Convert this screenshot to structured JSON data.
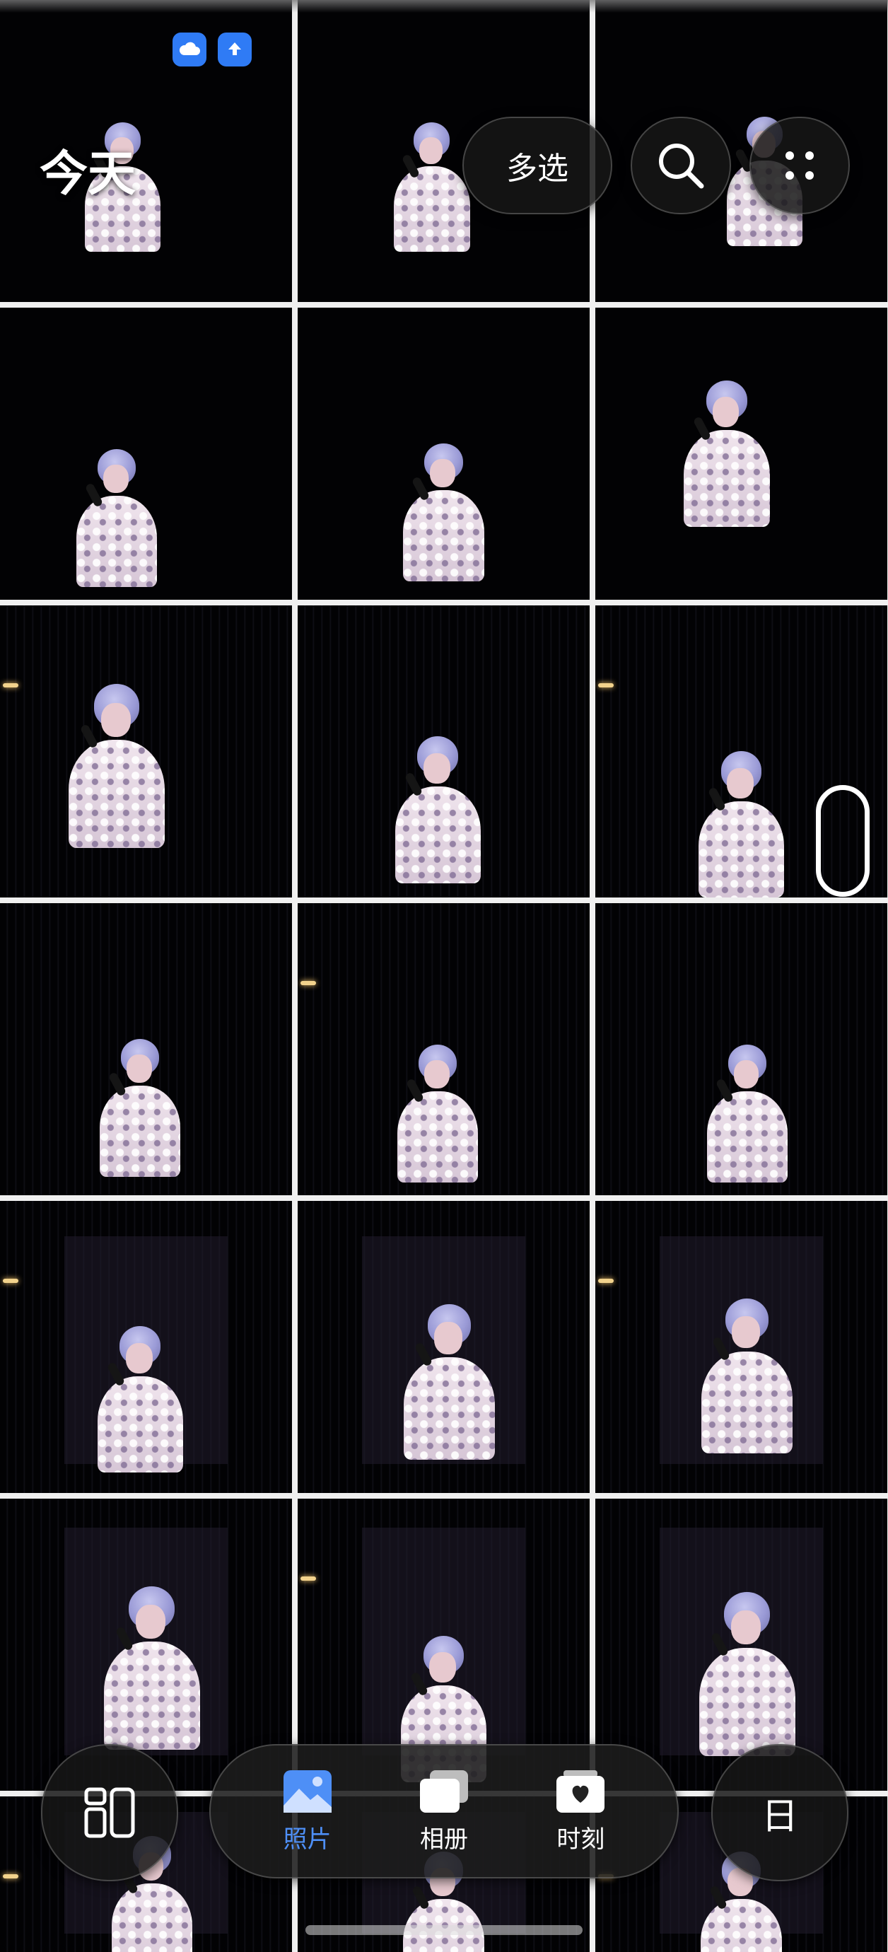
{
  "header": {
    "title": "今天",
    "multi_select_label": "多选",
    "search_icon": "search-icon",
    "more_icon": "more-grid-icon",
    "cloud_sync_icon": "cloud-icon",
    "upload_icon": "upload-icon"
  },
  "bottom_nav": {
    "layout_icon": "layout-switch-icon",
    "items": [
      {
        "label": "照片",
        "icon": "photo-icon",
        "active": true
      },
      {
        "label": "相册",
        "icon": "albums-icon",
        "active": false
      },
      {
        "label": "时刻",
        "icon": "moments-icon",
        "active": false
      }
    ],
    "day_label": "日"
  },
  "colors": {
    "accent": "#4e8ff6",
    "badge": "#2f7bf5",
    "background": "#000000"
  }
}
